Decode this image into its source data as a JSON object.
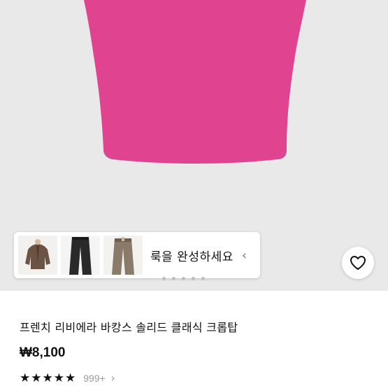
{
  "product": {
    "title": "프렌치 리비에라 바캉스 솔리드 클래식 크롭탑",
    "price": "₩8,100",
    "rating_stars": "★★★★★",
    "rating_value": 5,
    "review_count": "999+",
    "review_chevron": "›",
    "garment_color": "#e0438f"
  },
  "look_widget": {
    "label": "룩을 완성하세요",
    "chevron": "‹",
    "items": [
      {
        "icon": "jacket-thumbnail"
      },
      {
        "icon": "black-pants-thumbnail"
      },
      {
        "icon": "brown-pants-thumbnail"
      }
    ]
  },
  "favorite": {
    "icon": "heart-icon"
  }
}
